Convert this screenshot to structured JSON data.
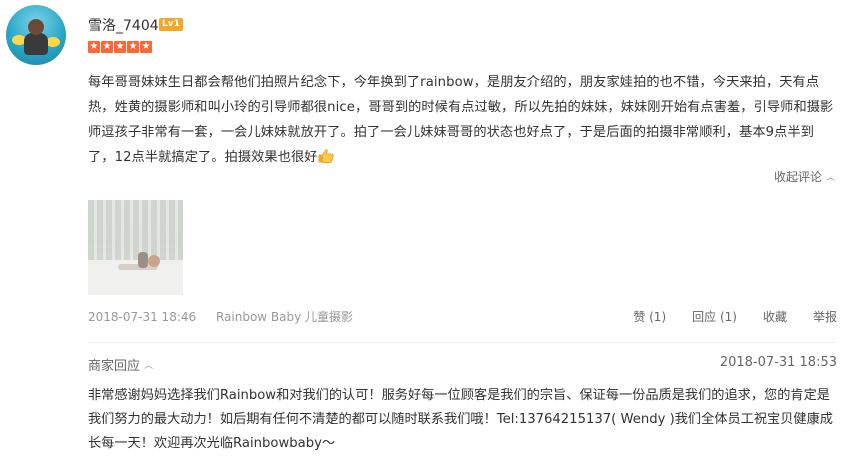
{
  "user": {
    "name": "雪洛_7404",
    "level": "Lv1",
    "stars": 5
  },
  "review": {
    "text": "每年哥哥妹妹生日都会帮他们拍照片纪念下，今年换到了rainbow，是朋友介绍的，朋友家娃拍的也不错，今天来拍，天有点热，姓黄的摄影师和叫小玲的引导师都很nice，哥哥到的时候有点过敏，所以先拍的妹妹，妹妹刚开始有点害羞，引导师和摄影师逗孩子非常有一套，一会儿妹妹就放开了。拍了一会儿妹妹哥哥的状态也好点了，于是后面的拍摄非常顺利，基本9点半到了，12点半就搞定了。拍摄效果也很好",
    "emoji": "thumbs-up-icon",
    "collapse_label": "收起评论",
    "date": "2018-07-31 18:46",
    "shop": "Rainbow Baby 儿童摄影",
    "actions": {
      "like": "赞 (1)",
      "reply": "回应 (1)",
      "favorite": "收藏",
      "report": "举报"
    }
  },
  "merchant_reply": {
    "label": "商家回应",
    "date": "2018-07-31 18:53",
    "text": "非常感谢妈妈选择我们Rainbow和对我们的认可！服务好每一位顾客是我们的宗旨、保证每一份品质是我们的追求，您的肯定是我们努力的最大动力！如后期有任何不清楚的都可以随时联系我们哦！Tel:13764215137( Wendy )我们全体员工祝宝贝健康成长每一天！欢迎再次光临Rainbowbaby～"
  },
  "colors": {
    "star": "#ff6633",
    "level_badge": "#f5a623",
    "text": "#333333",
    "muted": "#999999"
  }
}
